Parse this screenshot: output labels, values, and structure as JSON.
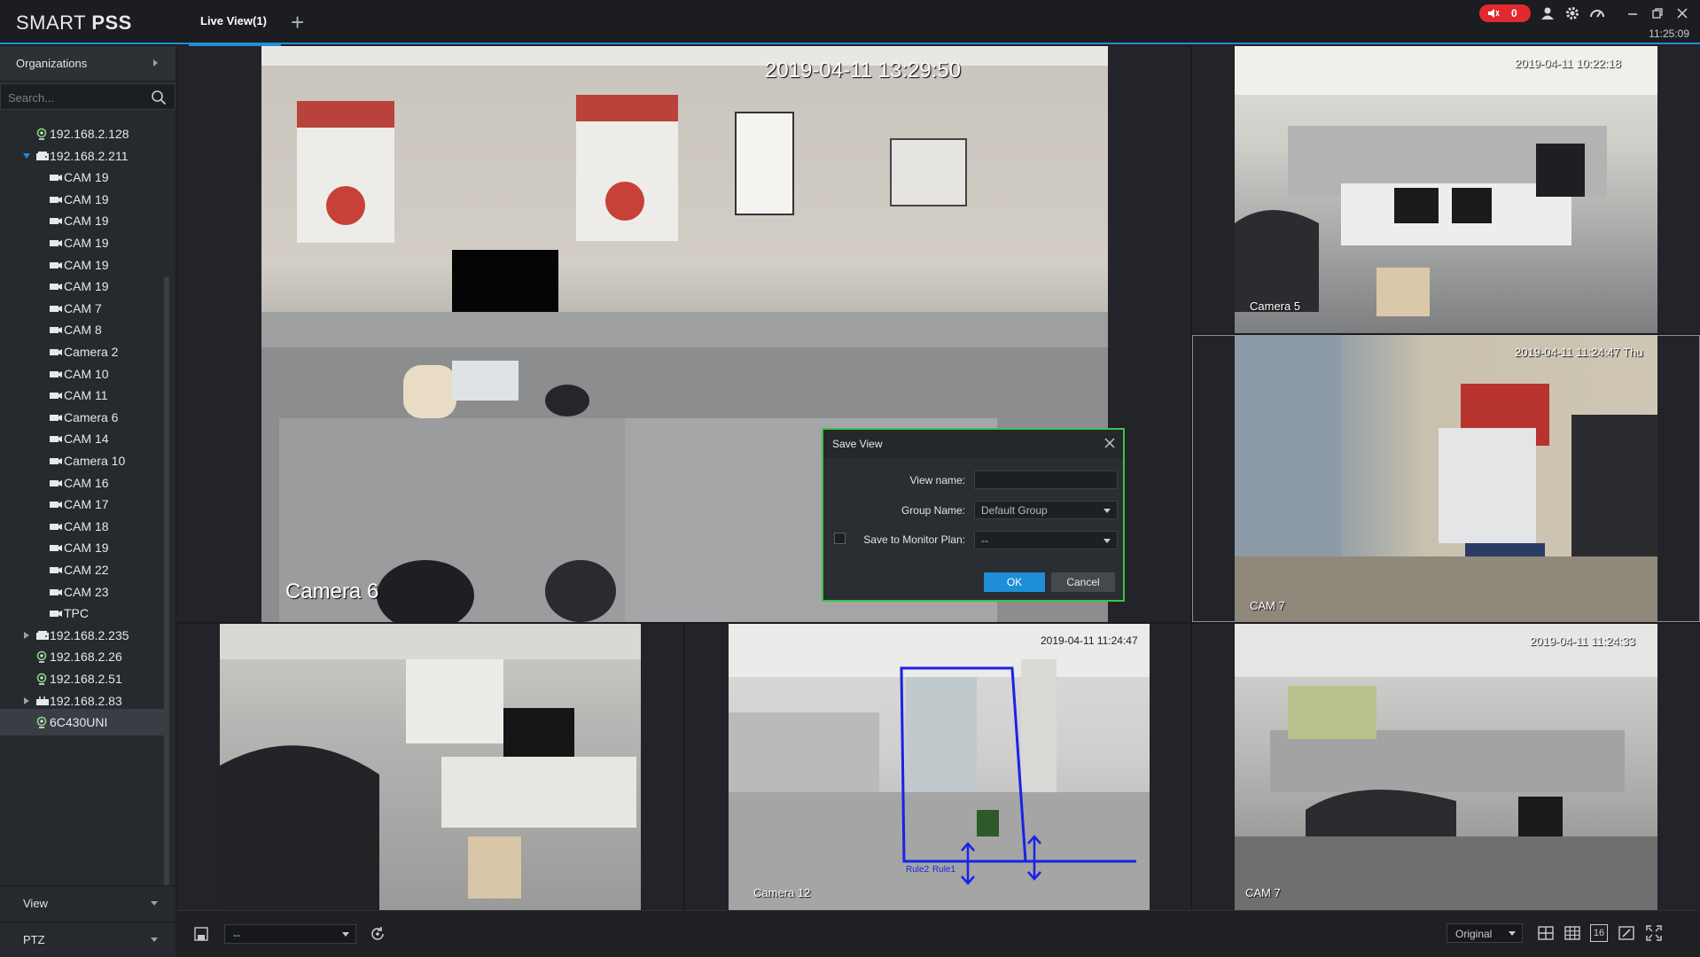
{
  "app": {
    "logo_light": "SMART ",
    "logo_bold": "PSS",
    "tab_label": "Live View(1)",
    "alarm_count": "0",
    "clock": "11:25:09"
  },
  "sidebar": {
    "organizations_label": "Organizations",
    "search_placeholder": "Search...",
    "tree": [
      {
        "label": "192.168.2.128",
        "type": "ipc",
        "level": 1,
        "expander": "none"
      },
      {
        "label": "192.168.2.211",
        "type": "nvr",
        "level": 1,
        "expander": "expanded"
      },
      {
        "label": "CAM 19",
        "type": "cam",
        "level": 2
      },
      {
        "label": "CAM 19",
        "type": "cam",
        "level": 2
      },
      {
        "label": "CAM 19",
        "type": "cam",
        "level": 2
      },
      {
        "label": "CAM 19",
        "type": "cam",
        "level": 2
      },
      {
        "label": "CAM 19",
        "type": "cam",
        "level": 2
      },
      {
        "label": "CAM 19",
        "type": "cam",
        "level": 2
      },
      {
        "label": "CAM 7",
        "type": "cam",
        "level": 2
      },
      {
        "label": "CAM 8",
        "type": "cam",
        "level": 2
      },
      {
        "label": "Camera 2",
        "type": "cam",
        "level": 2
      },
      {
        "label": "CAM 10",
        "type": "cam",
        "level": 2
      },
      {
        "label": "CAM 11",
        "type": "cam",
        "level": 2
      },
      {
        "label": "Camera 6",
        "type": "cam",
        "level": 2
      },
      {
        "label": "CAM 14",
        "type": "cam",
        "level": 2
      },
      {
        "label": "Camera 10",
        "type": "cam",
        "level": 2
      },
      {
        "label": "CAM 16",
        "type": "cam",
        "level": 2
      },
      {
        "label": "CAM 17",
        "type": "cam",
        "level": 2
      },
      {
        "label": "CAM 18",
        "type": "cam",
        "level": 2
      },
      {
        "label": "CAM 19",
        "type": "cam",
        "level": 2
      },
      {
        "label": "CAM 22",
        "type": "cam",
        "level": 2
      },
      {
        "label": "CAM 23",
        "type": "cam",
        "level": 2
      },
      {
        "label": "TPC",
        "type": "cam",
        "level": 2
      },
      {
        "label": "192.168.2.235",
        "type": "nvr",
        "level": 1,
        "expander": "collapsed"
      },
      {
        "label": "192.168.2.26",
        "type": "ipc",
        "level": 1,
        "expander": "none"
      },
      {
        "label": "192.168.2.51",
        "type": "ipc",
        "level": 1,
        "expander": "none"
      },
      {
        "label": "192.168.2.83",
        "type": "dvr",
        "level": 1,
        "expander": "collapsed"
      },
      {
        "label": "6C430UNI",
        "type": "ipc",
        "level": 1,
        "expander": "none",
        "selected": true
      }
    ],
    "view_label": "View",
    "ptz_label": "PTZ"
  },
  "tiles": {
    "main": {
      "timestamp": "2019-04-11 13:29:50",
      "name": "Camera 6"
    },
    "top_right": {
      "timestamp": "2019-04-11 10:22:18",
      "name": "Camera 5"
    },
    "mid_right": {
      "timestamp": "2019-04-11 11:24:47 Thu",
      "name": "CAM 7"
    },
    "bottom_left": {
      "timestamp": "",
      "name": ""
    },
    "bottom_mid": {
      "timestamp": "2019-04-11 11:24:47",
      "name": "Camera 12",
      "rule_labels": [
        "Rule2",
        "Rule1"
      ]
    },
    "bottom_right": {
      "timestamp": "2019-04-11 11:24:33",
      "name": "CAM 7"
    }
  },
  "dialog": {
    "title": "Save View",
    "view_name_label": "View name:",
    "view_name_value": "",
    "group_name_label": "Group Name:",
    "group_name_value": "Default Group",
    "monitor_plan_label": "Save to Monitor Plan:",
    "monitor_plan_value": "--",
    "monitor_plan_checked": false,
    "ok_label": "OK",
    "cancel_label": "Cancel"
  },
  "toolbar": {
    "view_select_value": "--",
    "stream_select_value": "Original",
    "layout_16_label": "16"
  },
  "colors": {
    "accent": "#1f8fd6",
    "alarm": "#e02a2f",
    "dialog_border": "#3ec24a",
    "ok_button": "#1e8ed8"
  }
}
